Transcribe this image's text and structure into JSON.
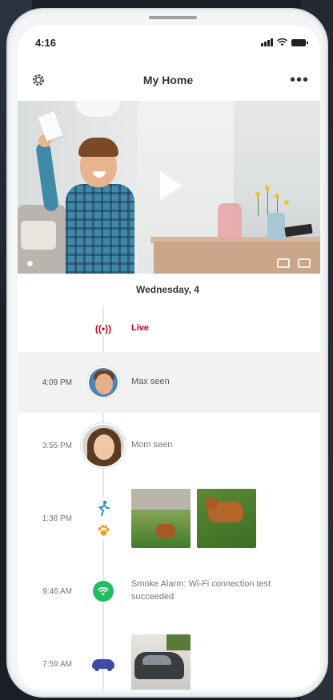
{
  "status_bar": {
    "time": "4:16"
  },
  "app_bar": {
    "title": "My Home",
    "settings_icon": "gear-icon",
    "more_label": "•••"
  },
  "timeline": {
    "date": "Wednesday, 4",
    "events": [
      {
        "time": "",
        "label": "Live",
        "icon": "live-broadcast-icon",
        "accent": "#d0021b"
      },
      {
        "time": "4:09 PM",
        "label": "Max seen",
        "icon": "avatar-max"
      },
      {
        "time": "3:55 PM",
        "label": "Mom seen",
        "icon": "avatar-mom"
      },
      {
        "time": "1:38 PM",
        "label": "",
        "icon": "motion-icon",
        "icon2": "pet-paw-icon"
      },
      {
        "time": "9:46 AM",
        "label": "Smoke Alarm: Wi-Fi connection test succeeded",
        "icon": "wifi-icon",
        "accent": "#1fbf5f"
      },
      {
        "time": "7:59 AM",
        "label": "",
        "icon": "car-icon",
        "accent": "#3e4aa8"
      }
    ]
  },
  "icons": {
    "live": "((•))",
    "motion": "🏃︎",
    "paw": "•",
    "play": "play-icon"
  }
}
